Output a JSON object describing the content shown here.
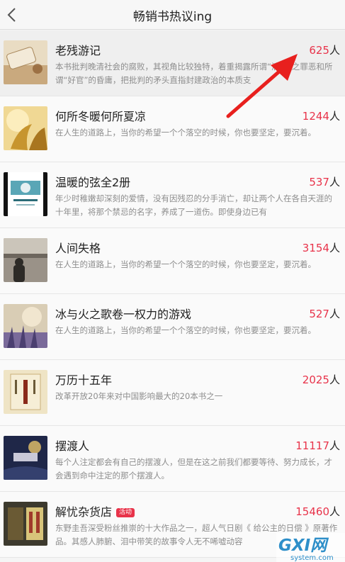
{
  "header": {
    "title": "畅销书热议ing"
  },
  "icons": {
    "back": "chevron-left-icon",
    "annotation": "red-arrow-icon"
  },
  "colors": {
    "accent": "#e8334a",
    "desc": "#8d8d8d"
  },
  "books": [
    {
      "title": "老残游记",
      "count": "625",
      "unit": "人",
      "tag": "",
      "desc": "本书批判晚清社会的腐败，其视角比较独特，着重揭露所谓“清官”之罪恶和所谓“好官”的昏庸，把批判的矛头直指封建政治的本质支"
    },
    {
      "title": "何所冬暖何所夏凉",
      "count": "1244",
      "unit": "人",
      "tag": "",
      "desc": "在人生的道路上，当你的希望一个个落空的时候，你也要坚定，要沉着。"
    },
    {
      "title": "温暖的弦全2册",
      "count": "537",
      "unit": "人",
      "tag": "",
      "desc": "年少时稚嫩却深刻的爱情，没有因残忍的分手消亡，却让两个人在各自天涯的十年里，将那个禁忌的名字，养成了一道伤。即使身边已有"
    },
    {
      "title": "人间失格",
      "count": "3154",
      "unit": "人",
      "tag": "",
      "desc": "在人生的道路上，当你的希望一个个落空的时候，你也要坚定，要沉着。"
    },
    {
      "title": "冰与火之歌卷一权力的游戏",
      "count": "527",
      "unit": "人",
      "tag": "",
      "desc": "在人生的道路上，当你的希望一个个落空的时候，你也要坚定，要沉着。"
    },
    {
      "title": "万历十五年",
      "count": "2025",
      "unit": "人",
      "tag": "",
      "desc": "改革开放20年来对中国影响最大的20本书之一"
    },
    {
      "title": "摆渡人",
      "count": "11117",
      "unit": "人",
      "tag": "",
      "desc": "每个人注定都会有自己的摆渡人，但是在这之前我们都要等待、努力成长，才会遇到命中注定的那个摆渡人。"
    },
    {
      "title": "解忧杂货店",
      "count": "15460",
      "unit": "人",
      "tag": "活动",
      "desc": "东野圭吾深受粉丝推崇的十大作品之一，超人气日剧《 给公主的日偿 》原著作品。其感人肺腑、泪中带笑的故事令人无不唏嘘动容"
    }
  ],
  "watermark": {
    "brand": "GXI网",
    "domain": "system.com"
  }
}
